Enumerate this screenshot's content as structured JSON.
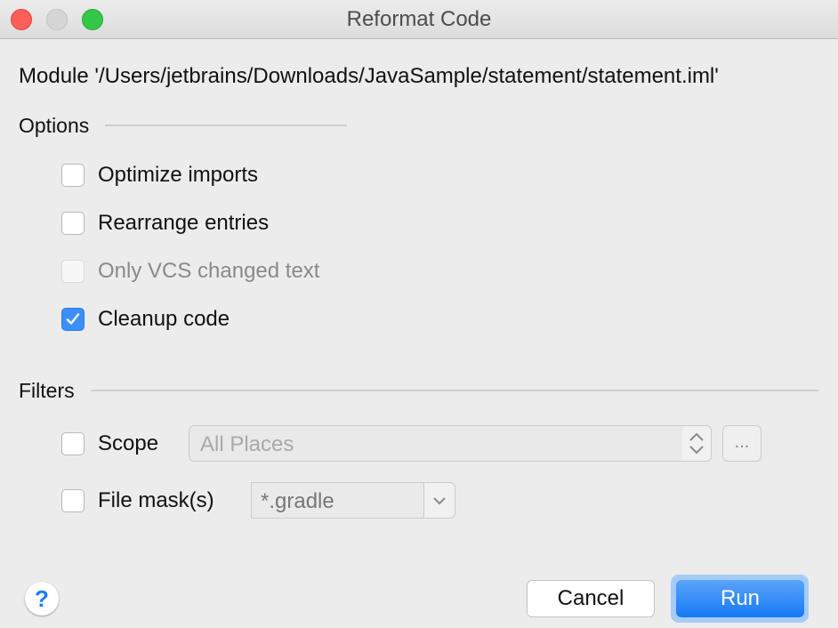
{
  "window": {
    "title": "Reformat Code",
    "controls": [
      "close",
      "minimize",
      "maximize"
    ]
  },
  "module_label": "Module '/Users/jetbrains/Downloads/JavaSample/statement/statement.iml'",
  "options": {
    "heading": "Options",
    "items": [
      {
        "label": "Optimize imports",
        "checked": false,
        "enabled": true
      },
      {
        "label": "Rearrange entries",
        "checked": false,
        "enabled": true
      },
      {
        "label": "Only VCS changed text",
        "checked": false,
        "enabled": false
      },
      {
        "label": "Cleanup code",
        "checked": true,
        "enabled": true
      }
    ]
  },
  "filters": {
    "heading": "Filters",
    "scope": {
      "label": "Scope",
      "checked": false,
      "value": "All Places",
      "browse_label": "..."
    },
    "file_mask": {
      "label": "File mask(s)",
      "checked": false,
      "value": "*.gradle"
    }
  },
  "footer": {
    "help_label": "?",
    "cancel_label": "Cancel",
    "run_label": "Run"
  },
  "colors": {
    "accent": "#1a7cf5",
    "checkbox_checked": "#3d8ef7",
    "close": "#fc5f57",
    "maximize": "#34c84a"
  }
}
